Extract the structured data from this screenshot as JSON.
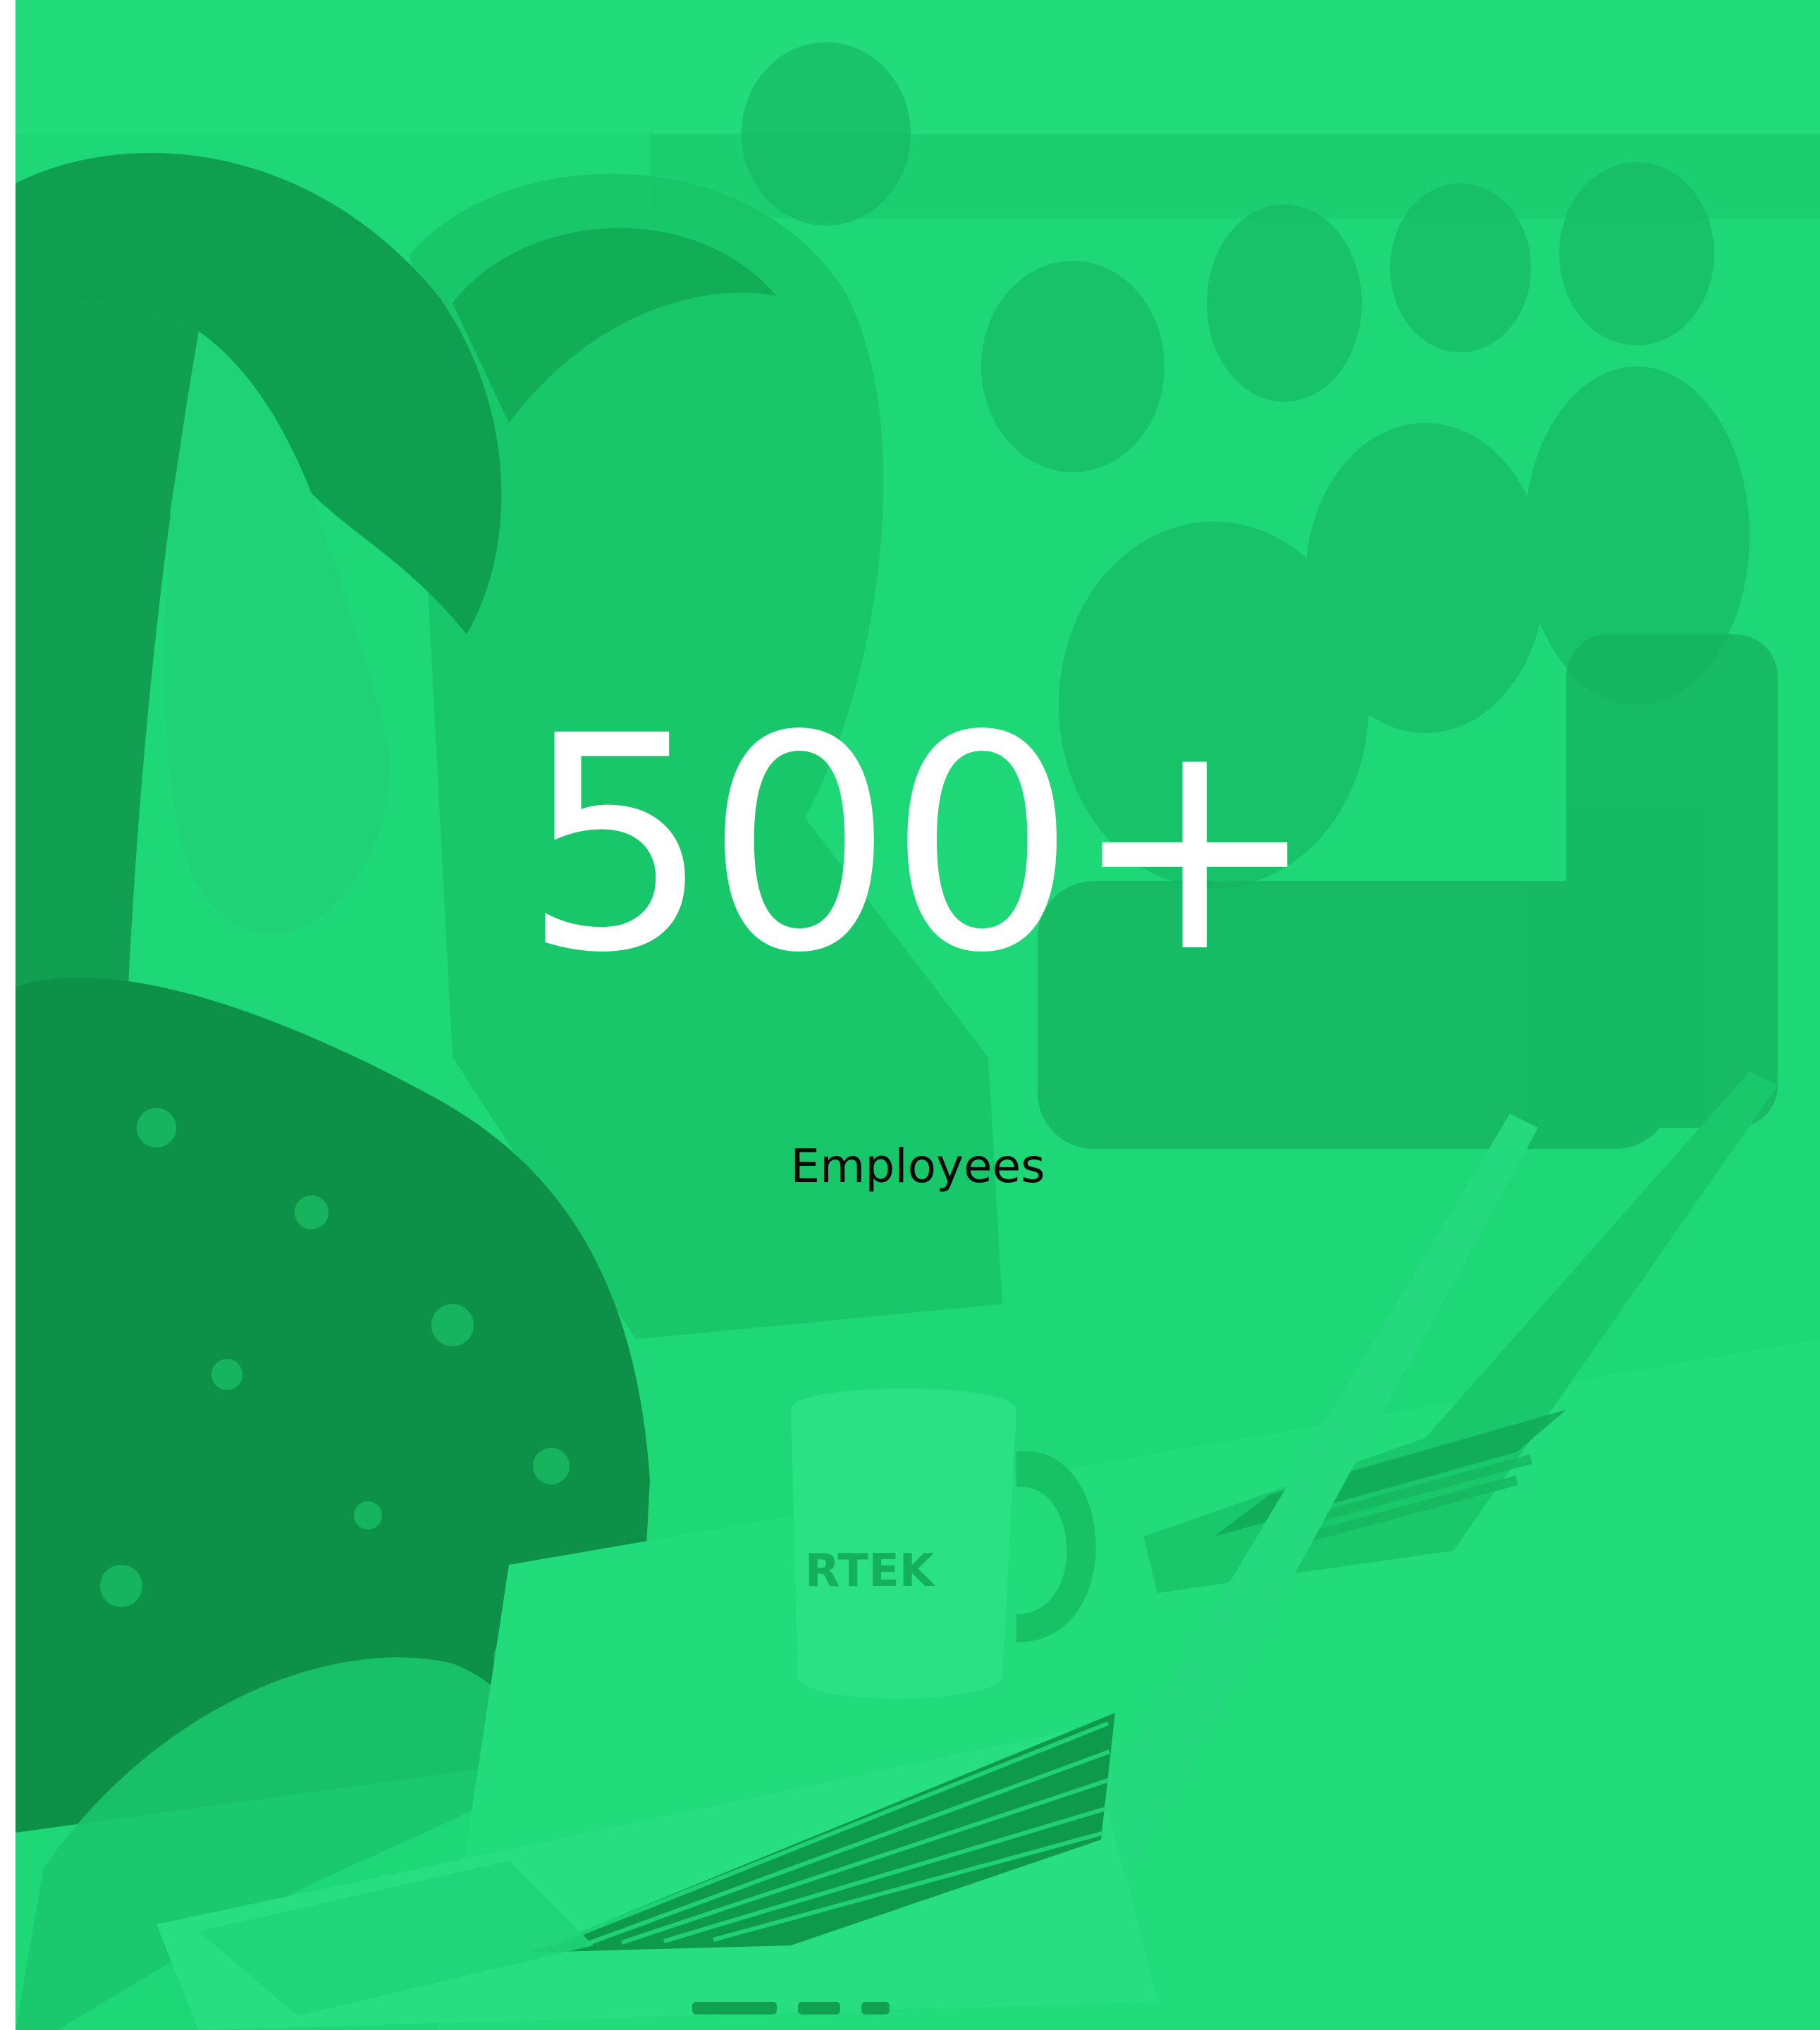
{
  "stat": {
    "value": "500+",
    "label": "Employees"
  },
  "mug": {
    "brand_text": "RTEK"
  },
  "colors": {
    "background_overlay": "#1ed877",
    "value_text": "#ffffff",
    "label_text": "#0a0a0a"
  }
}
